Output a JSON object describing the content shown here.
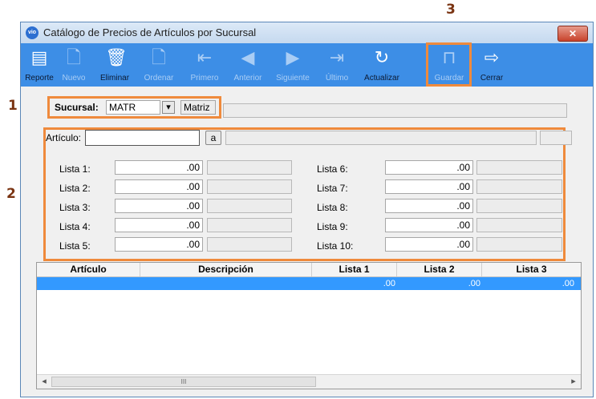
{
  "callouts": {
    "one": "1",
    "two": "2",
    "three": "3"
  },
  "window": {
    "title": "Catálogo de Precios de Artículos por Sucursal",
    "app_icon_text": "vio",
    "close_glyph": "✕"
  },
  "toolbar": {
    "buttons": [
      {
        "label": "Reporte",
        "icon": "report-icon",
        "glyph": "▤",
        "enabled": true
      },
      {
        "label": "Nuevo",
        "icon": "new-document-icon",
        "glyph": "🗋",
        "enabled": false
      },
      {
        "label": "Eliminar",
        "icon": "trash-icon",
        "glyph": "🗑",
        "enabled": true
      },
      {
        "label": "Ordenar",
        "icon": "sort-document-icon",
        "glyph": "🗋",
        "enabled": false
      },
      {
        "label": "Primero",
        "icon": "first-arrow-icon",
        "glyph": "⇤",
        "enabled": false
      },
      {
        "label": "Anterior",
        "icon": "previous-arrow-icon",
        "glyph": "◀",
        "enabled": false
      },
      {
        "label": "Siguiente",
        "icon": "next-arrow-icon",
        "glyph": "▶",
        "enabled": false
      },
      {
        "label": "Último",
        "icon": "last-arrow-icon",
        "glyph": "⇥",
        "enabled": false
      },
      {
        "label": "Actualizar",
        "icon": "refresh-icon",
        "glyph": "↻",
        "enabled": true
      },
      {
        "label": "Guardar",
        "icon": "save-icon",
        "glyph": "⊓",
        "enabled": false
      },
      {
        "label": "Cerrar",
        "icon": "exit-icon",
        "glyph": "⇨",
        "enabled": true
      }
    ]
  },
  "sucursal": {
    "label": "Sucursal:",
    "value": "MATR",
    "name": "Matriz",
    "dropdown_glyph": "▾"
  },
  "articulo": {
    "label": "Artículo:",
    "value": "",
    "lookup_button": "a"
  },
  "listas": {
    "left": [
      {
        "label": "Lista 1:",
        "value": ".00"
      },
      {
        "label": "Lista 2:",
        "value": ".00"
      },
      {
        "label": "Lista 3:",
        "value": ".00"
      },
      {
        "label": "Lista 4:",
        "value": ".00"
      },
      {
        "label": "Lista 5:",
        "value": ".00"
      }
    ],
    "right": [
      {
        "label": "Lista 6:",
        "value": ".00"
      },
      {
        "label": "Lista 7:",
        "value": ".00"
      },
      {
        "label": "Lista 8:",
        "value": ".00"
      },
      {
        "label": "Lista 9:",
        "value": ".00"
      },
      {
        "label": "Lista 10:",
        "value": ".00"
      }
    ]
  },
  "grid": {
    "columns": [
      "Artículo",
      "Descripción",
      "Lista 1",
      "Lista 2",
      "Lista 3"
    ],
    "rows": [
      {
        "articulo": "",
        "descripcion": "",
        "lista1": ".00",
        "lista2": ".00",
        "lista3": ".00"
      }
    ],
    "scroll_left": "◂",
    "scroll_thumb": "III",
    "scroll_right": "▸"
  }
}
